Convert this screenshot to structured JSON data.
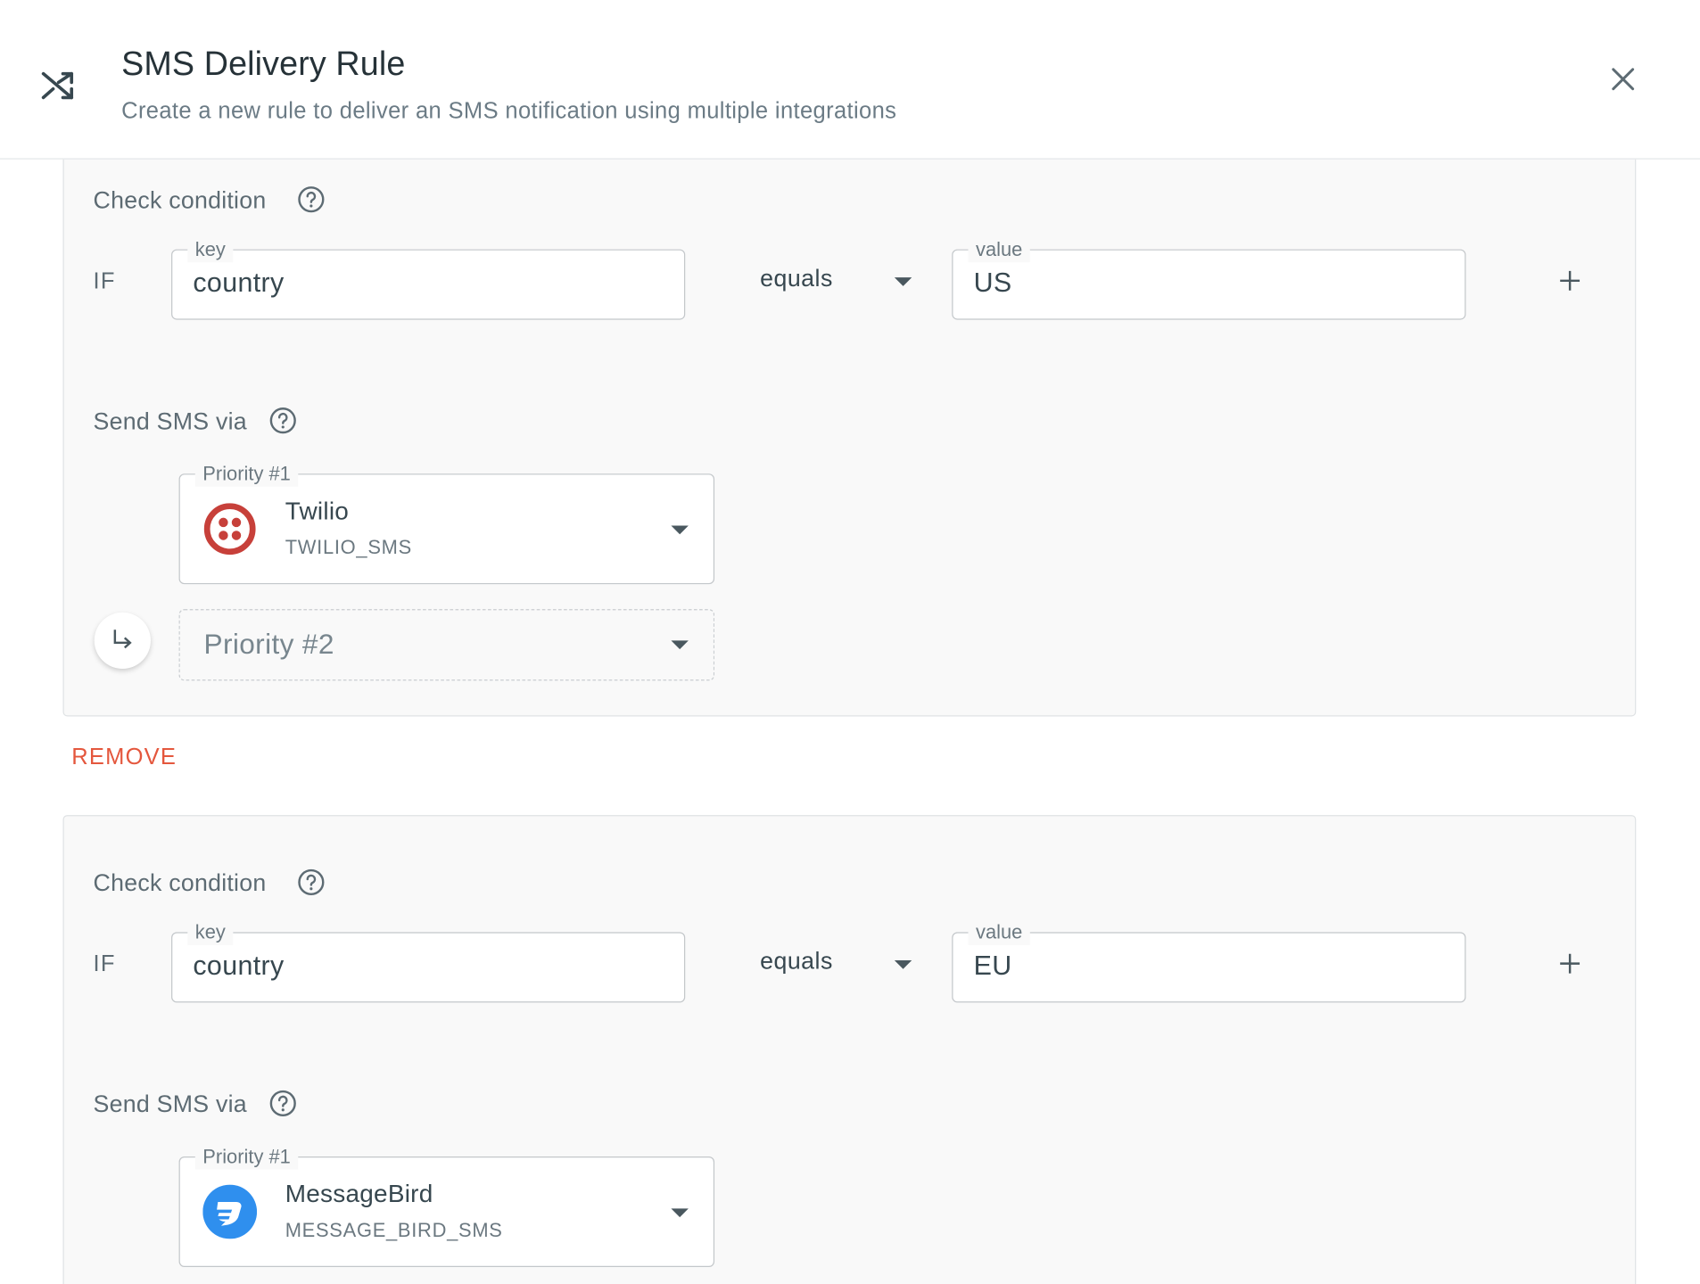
{
  "header": {
    "title": "SMS Delivery Rule",
    "subtitle": "Create a new rule to deliver an SMS notification using multiple integrations"
  },
  "rules": [
    {
      "check_condition_label": "Check condition",
      "if_label": "IF",
      "key": {
        "label": "key",
        "value": "country"
      },
      "operator": "equals",
      "value": {
        "label": "value",
        "value": "US"
      },
      "send_via_label": "Send SMS via",
      "priorities": [
        {
          "label": "Priority #1",
          "provider_name": "Twilio",
          "provider_id": "TWILIO_SMS",
          "logo_icon": "twilio-logo-icon",
          "color": "#c7403a"
        }
      ],
      "next_priority_placeholder": "Priority #2"
    },
    {
      "check_condition_label": "Check condition",
      "if_label": "IF",
      "key": {
        "label": "key",
        "value": "country"
      },
      "operator": "equals",
      "value": {
        "label": "value",
        "value": "EU"
      },
      "send_via_label": "Send SMS via",
      "priorities": [
        {
          "label": "Priority #1",
          "provider_name": "MessageBird",
          "provider_id": "MESSAGE_BIRD_SMS",
          "logo_icon": "messagebird-logo-icon",
          "color": "#2f8fee"
        }
      ]
    }
  ],
  "remove_label": "REMOVE",
  "colors": {
    "remove": "#e4573d",
    "card_bg": "#f9f9f9",
    "border": "#c3c7ca"
  }
}
